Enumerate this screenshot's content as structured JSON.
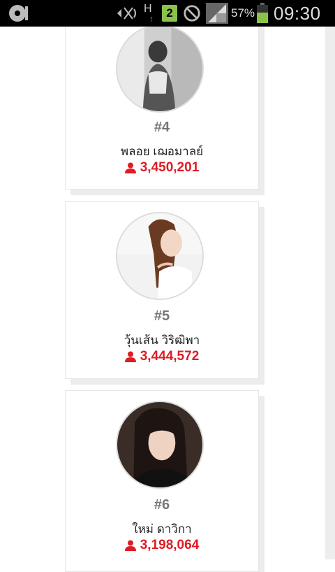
{
  "status_bar": {
    "icons": [
      "record-icon",
      "signal-muted-icon",
      "network-h-icon",
      "sim-2-icon",
      "blocked-icon",
      "cell-signal-icon",
      "battery-icon"
    ],
    "network_label": "H",
    "sim_label": "2",
    "battery_percent": "57%",
    "battery_level": 0.57,
    "time": "09:30"
  },
  "colors": {
    "accent": "#e01b24",
    "rank_text": "#777777",
    "card_shadow": "#ececec",
    "battery_green": "#8bc34a"
  },
  "cards": [
    {
      "rank": "#4",
      "name": "พลอย เฌอมาลย์",
      "count": "3,450,201",
      "avatar_icon": "profile-photo"
    },
    {
      "rank": "#5",
      "name": "วุ้นเส้น วิริฒิพา",
      "count": "3,444,572",
      "avatar_icon": "profile-photo"
    },
    {
      "rank": "#6",
      "name": "ใหม่ ดาวิกา",
      "count": "3,198,064",
      "avatar_icon": "profile-photo"
    }
  ]
}
